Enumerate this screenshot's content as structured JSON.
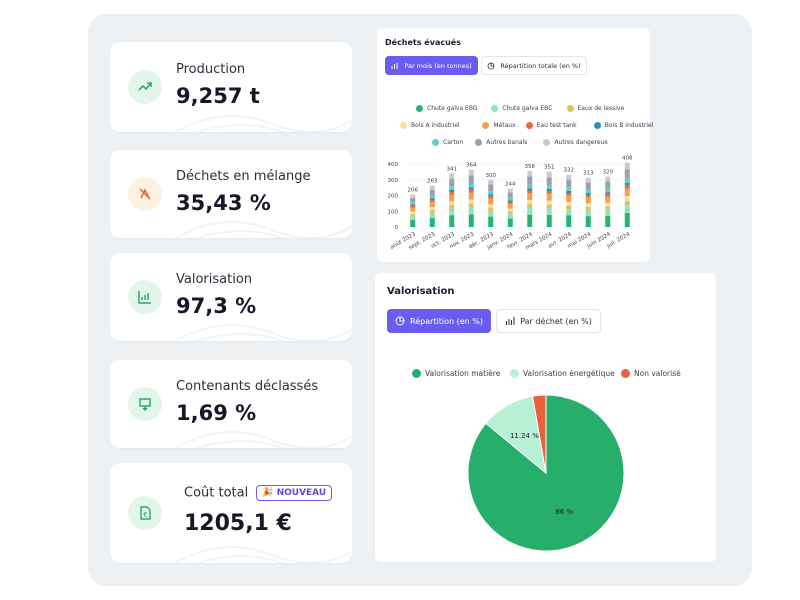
{
  "kpis": [
    {
      "label": "Production",
      "value": "9,257 t",
      "icon": "trend-up-icon",
      "icon_bg": "#e3f6ec",
      "icon_color": "#2fa86a"
    },
    {
      "label": "Déchets en mélange",
      "value": "35,43 %",
      "icon": "recycle-strike-icon",
      "icon_bg": "#fdf1e2",
      "icon_color": "#e06a2f"
    },
    {
      "label": "Valorisation",
      "value": "97,3 %",
      "icon": "chart-leaf-icon",
      "icon_bg": "#e3f6ec",
      "icon_color": "#2fa86a"
    },
    {
      "label": "Contenants déclassés",
      "value": "1,69 %",
      "icon": "container-down-icon",
      "icon_bg": "#e3f6ec",
      "icon_color": "#2fa86a"
    },
    {
      "label": "Coût total",
      "value": "1205,1 €",
      "icon": "euro-document-icon",
      "icon_bg": "#e3f6ec",
      "icon_color": "#2fa86a",
      "badge": "NOUVEAU"
    }
  ],
  "dechets": {
    "title": "Déchets évacués",
    "tabs": [
      {
        "label": "Par mois (en tonnes)",
        "active": true
      },
      {
        "label": "Répartition totale (en %)",
        "active": false
      }
    ]
  },
  "valorisation": {
    "title": "Valorisation",
    "tabs": [
      {
        "label": "Répartition (en %)",
        "active": true
      },
      {
        "label": "Par déchet (en %)",
        "active": false
      }
    ]
  },
  "chart_data": [
    {
      "type": "bar",
      "stacked": true,
      "title": "Déchets évacués",
      "categories": [
        "août 2023",
        "sept. 2023",
        "oct. 2023",
        "nov. 2023",
        "déc. 2023",
        "janv. 2024",
        "févr. 2024",
        "mars 2024",
        "avr. 2024",
        "mai 2024",
        "juin 2024",
        "juil. 2024"
      ],
      "totals": [
        206,
        263,
        341,
        364,
        300,
        244,
        356,
        351,
        332,
        313,
        320,
        408
      ],
      "ylim": [
        0,
        400
      ],
      "yticks": [
        0,
        100,
        200,
        300,
        400
      ],
      "series": [
        {
          "name": "Chute galva EBG",
          "color": "#22b573"
        },
        {
          "name": "Chute galva EBC",
          "color": "#8fe3c3"
        },
        {
          "name": "Eaux de lessive",
          "color": "#e2c15a"
        },
        {
          "name": "Bois A industriel",
          "color": "#f8dfa8"
        },
        {
          "name": "Métaux",
          "color": "#f2a049"
        },
        {
          "name": "Eau test tank",
          "color": "#e86a47"
        },
        {
          "name": "Bois B industriel",
          "color": "#2a8fb1"
        },
        {
          "name": "Carton",
          "color": "#5fd0c8"
        },
        {
          "name": "Autres banals",
          "color": "#9aa1ab"
        },
        {
          "name": "Autres dangereux",
          "color": "#c8ccd2"
        }
      ],
      "legend_position": "top"
    },
    {
      "type": "pie",
      "title": "Valorisation",
      "labels": [
        "Valorisation matière",
        "Valorisation énergétique",
        "Non valorisé"
      ],
      "values": [
        86,
        11.24,
        2.76
      ],
      "data_labels": [
        "86 %",
        "11.24 %",
        ""
      ],
      "colors": [
        "#27ae6b",
        "#b8f0d6",
        "#e8603c"
      ],
      "legend_position": "top"
    }
  ]
}
